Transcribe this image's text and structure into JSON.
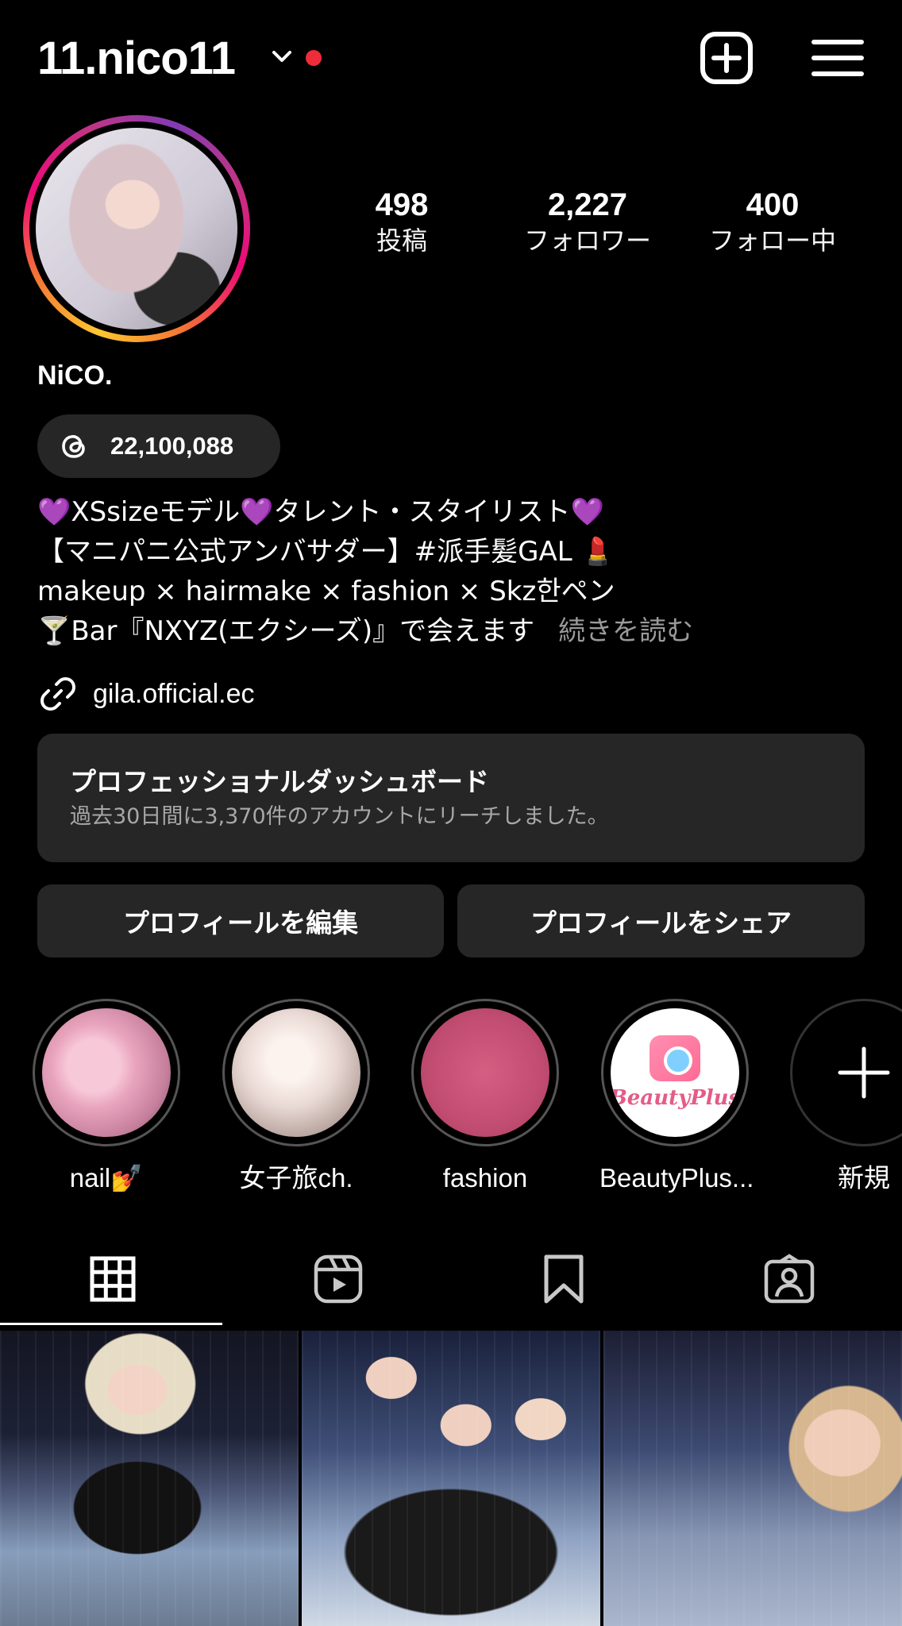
{
  "header": {
    "username": "11.nico11",
    "has_notification_dot": true,
    "notification_color": "#ef2d3a",
    "add_icon": "plus-square-icon",
    "menu_icon": "hamburger-menu-icon"
  },
  "profile": {
    "display_name": "NiCO.",
    "stats": [
      {
        "value": "498",
        "label": "投稿"
      },
      {
        "value": "2,227",
        "label": "フォロワー"
      },
      {
        "value": "400",
        "label": "フォロー中"
      }
    ],
    "threads_count": "22,100,088",
    "bio": {
      "line1": "XSsizeモデル",
      "line1b": "タレント・スタイリスト",
      "heart": "💜",
      "line2": "【マニパニ公式アンバサダー】#派手髪GAL 💄",
      "line3": "makeup × hairmake × fashion × Skz한ペン",
      "line4": "🍸Bar『NXYZ(エクシーズ)』で会えます",
      "more": "続きを読む"
    },
    "link": "gila.official.ec"
  },
  "dashboard": {
    "title": "プロフェッショナルダッシュボード",
    "subtitle": "過去30日間に3,370件のアカウントにリーチしました。"
  },
  "buttons": {
    "edit": "プロフィールを編集",
    "share": "プロフィールをシェア"
  },
  "highlights": [
    {
      "label": "nail💅"
    },
    {
      "label": "女子旅ch."
    },
    {
      "label": "fashion"
    },
    {
      "label": "BeautyPlus..."
    },
    {
      "label": "新規"
    }
  ],
  "highlight_logo_text": "BeautyPlus",
  "tabs": [
    "grid-icon",
    "reels-icon",
    "saved-icon",
    "tagged-icon"
  ],
  "colors": {
    "accent_bg": "#262626",
    "heart": "#a64bf4",
    "muted_text": "#a8a8a8"
  }
}
